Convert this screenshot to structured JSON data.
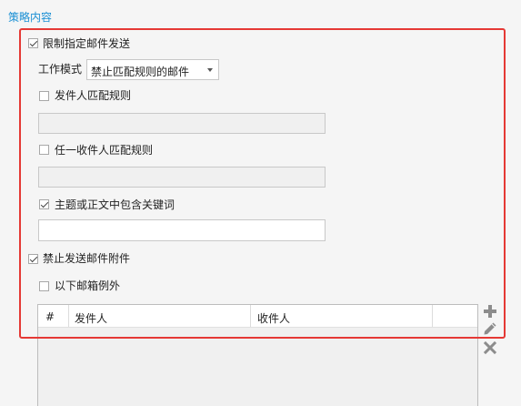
{
  "section": {
    "title": "策略内容"
  },
  "policy": {
    "restrict_send": {
      "label": "限制指定邮件发送",
      "checked": true
    },
    "work_mode": {
      "label": "工作模式",
      "value": "禁止匹配规则的邮件"
    },
    "sender_match": {
      "label": "发件人匹配规则",
      "checked": false,
      "value": ""
    },
    "recipient_match": {
      "label": "任一收件人匹配规则",
      "checked": false,
      "value": ""
    },
    "keyword_match": {
      "label": "主题或正文中包含关键词",
      "checked": true,
      "value": ""
    },
    "block_attachments": {
      "label": "禁止发送邮件附件",
      "checked": true
    },
    "except_mailboxes": {
      "label": "以下邮箱例外",
      "checked": false
    }
  },
  "exception_table": {
    "columns": [
      "#",
      "发件人",
      "收件人"
    ],
    "rows": []
  },
  "toolbar": {
    "add_icon": "plus-icon",
    "edit_icon": "pencil-icon",
    "delete_icon": "x-icon"
  },
  "colors": {
    "accent": "#1a8fd4",
    "highlight": "#e53935",
    "tool_icon": "#8c8c8c"
  }
}
